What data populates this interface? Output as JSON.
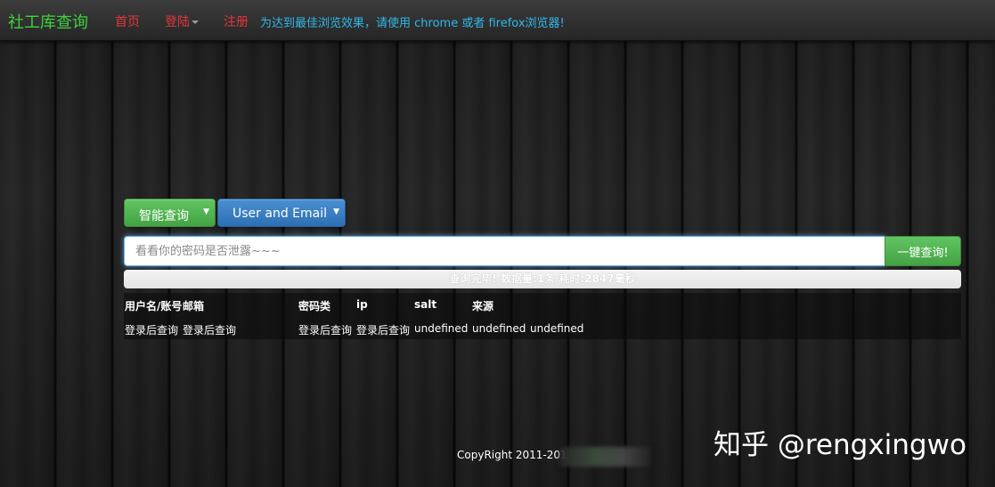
{
  "navbar": {
    "brand": "社工库查询",
    "home": "首页",
    "login": "登陆",
    "register": "注册",
    "notice": "为达到最佳浏览效果，请使用 chrome 或者 firefox浏览器!"
  },
  "query": {
    "mode_label": "智能查询",
    "type_label": "User and Email",
    "placeholder": "看看你的密码是否泄露~~~",
    "search_label": "一键查询!"
  },
  "status": {
    "text": "查询完毕! 数据量:1条 耗时:2847毫秒"
  },
  "results": {
    "columns": [
      "用户名/账号",
      "邮箱",
      "密码",
      "类",
      "ip",
      "salt",
      "来源"
    ],
    "row": [
      "登录后查询",
      "登录后查询",
      "登录后查询",
      "登录后查询",
      "undefined",
      "undefined",
      "undefined"
    ]
  },
  "footer": {
    "copyright": "CopyRight 2011-201"
  },
  "watermark": "知乎 @rengxingwo",
  "colors": {
    "brand": "#3fd03f",
    "nav_link": "#e5343c",
    "notice": "#2fb8e8",
    "btn_green": "#5cb85c",
    "btn_blue": "#337ab7"
  }
}
